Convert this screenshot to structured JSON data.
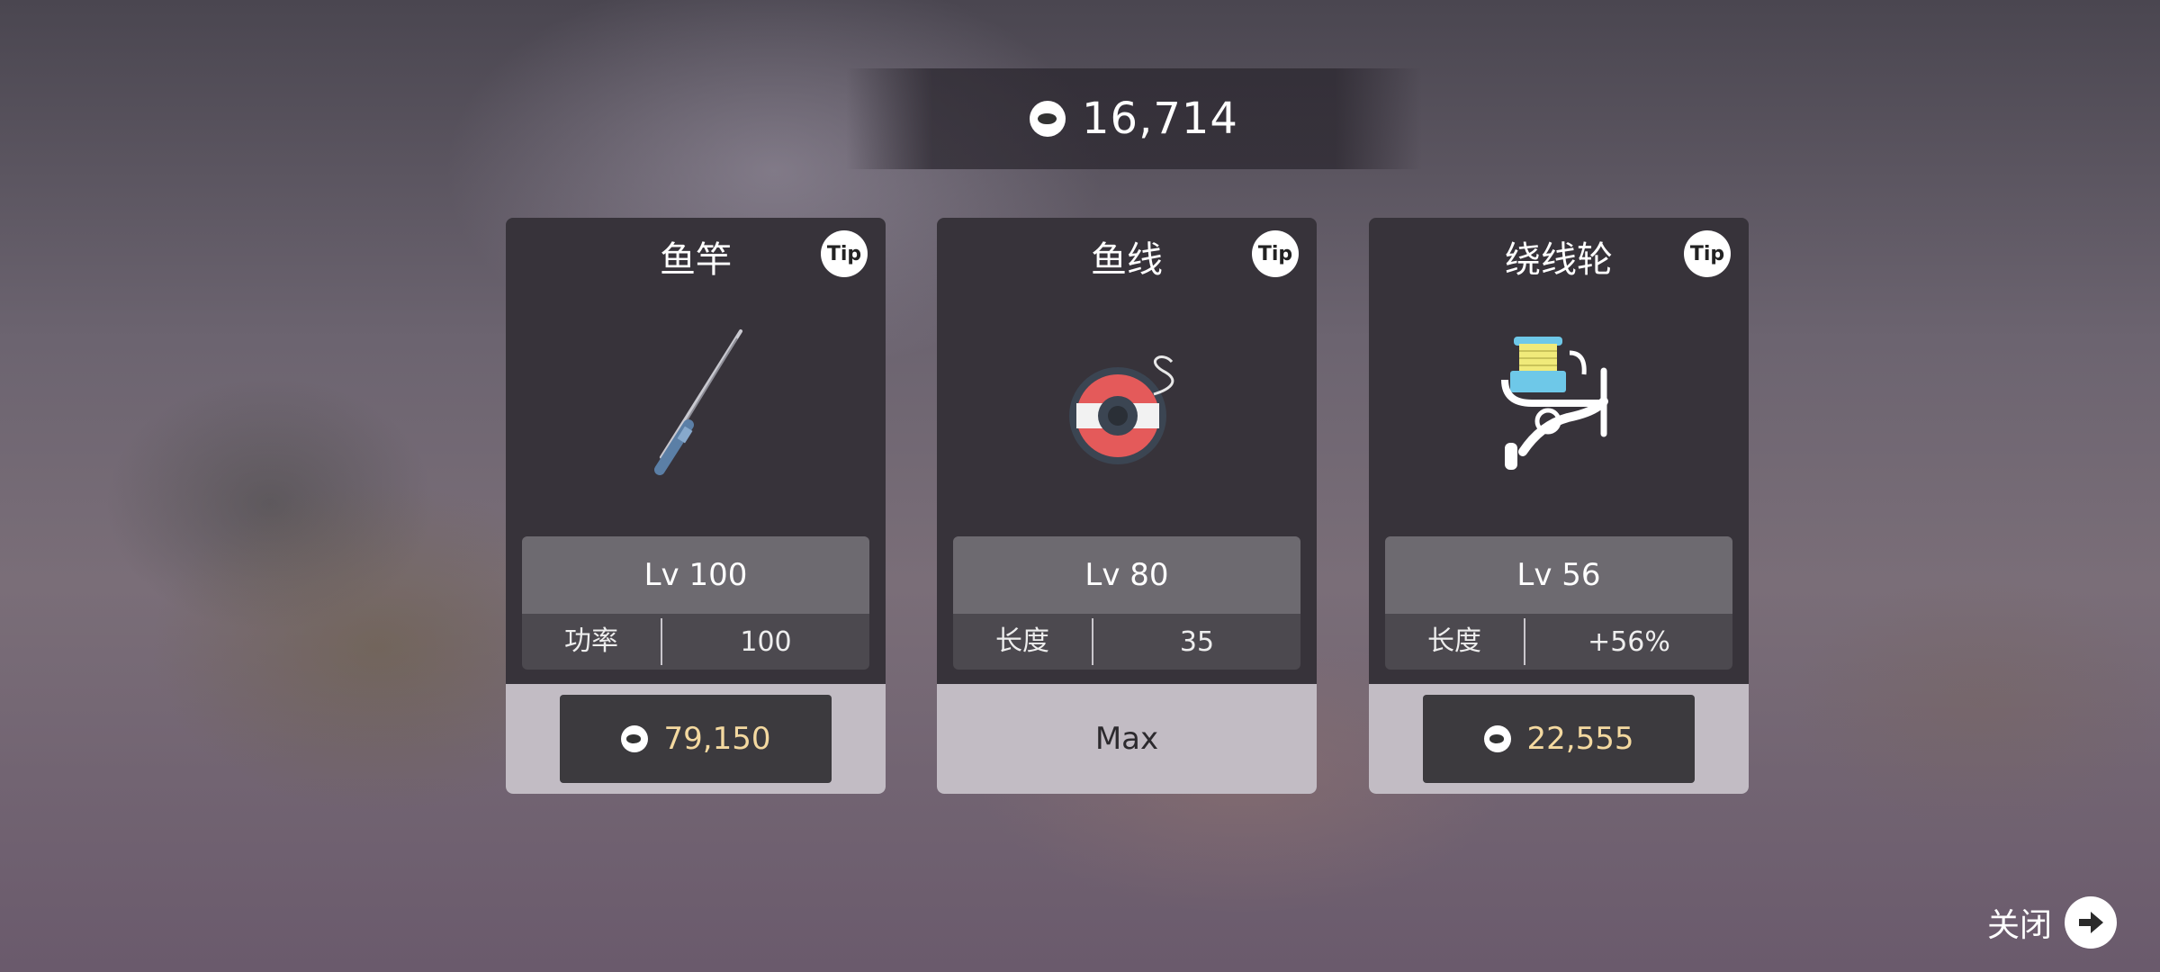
{
  "balance": {
    "icon": "fish-coin-icon",
    "value": "16,714"
  },
  "cards": [
    {
      "title": "鱼竿",
      "tip": "Tip",
      "image": "fishing-rod-icon",
      "level": "Lv 100",
      "stat_label": "功率",
      "stat_value": "100",
      "price": "79,150"
    },
    {
      "title": "鱼线",
      "tip": "Tip",
      "image": "fishing-line-spool-icon",
      "level": "Lv 80",
      "stat_label": "长度",
      "stat_value": "35",
      "max_label": "Max"
    },
    {
      "title": "绕线轮",
      "tip": "Tip",
      "image": "fishing-reel-icon",
      "level": "Lv 56",
      "stat_label": "长度",
      "stat_value": "+56%",
      "price": "22,555"
    }
  ],
  "close": {
    "label": "关闭",
    "icon": "arrow-right-icon"
  },
  "colors": {
    "price": "#f4d9a0",
    "card_bg": "#37333a",
    "footer_bg": "#c2bcc4"
  }
}
